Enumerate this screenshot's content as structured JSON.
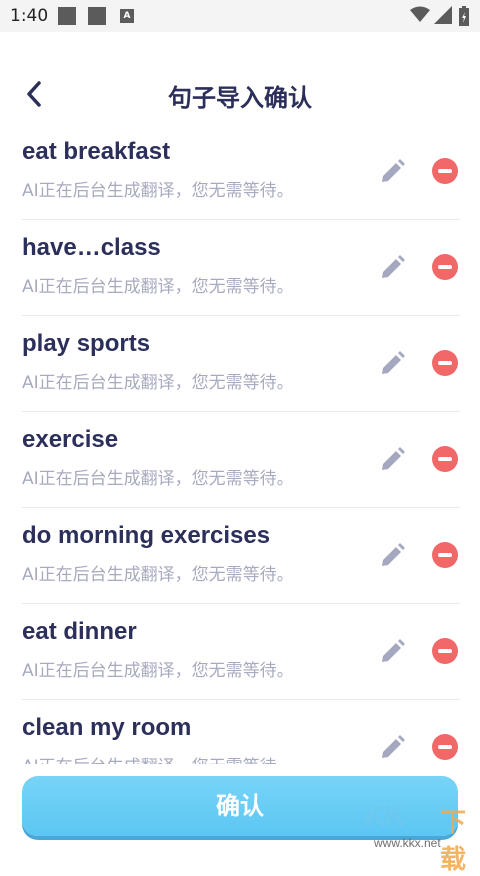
{
  "status_bar": {
    "time": "1:40",
    "notification_letter": "A"
  },
  "header": {
    "title": "句子导入确认"
  },
  "sentences": [
    {
      "text": "eat breakfast",
      "status": "AI正在后台生成翻译，您无需等待。"
    },
    {
      "text": "have…class",
      "status": "AI正在后台生成翻译，您无需等待。"
    },
    {
      "text": "play sports",
      "status": "AI正在后台生成翻译，您无需等待。"
    },
    {
      "text": "exercise",
      "status": "AI正在后台生成翻译，您无需等待。"
    },
    {
      "text": "do morning exercises",
      "status": "AI正在后台生成翻译，您无需等待。"
    },
    {
      "text": "eat dinner",
      "status": "AI正在后台生成翻译，您无需等待。"
    },
    {
      "text": "clean my room",
      "status": "AI正在后台生成翻译，您无需等待。"
    }
  ],
  "footer": {
    "confirm_label": "确认"
  },
  "watermark": {
    "logo": "KK",
    "char": "下载",
    "url": "www.kkx.net"
  },
  "colors": {
    "accent": "#5cc6f3",
    "delete": "#f26767",
    "title": "#2b2f5a",
    "subtext": "#a7aac0"
  },
  "icons": {
    "back": "back-arrow-icon",
    "edit": "pencil-icon",
    "delete": "minus-circle-icon"
  }
}
